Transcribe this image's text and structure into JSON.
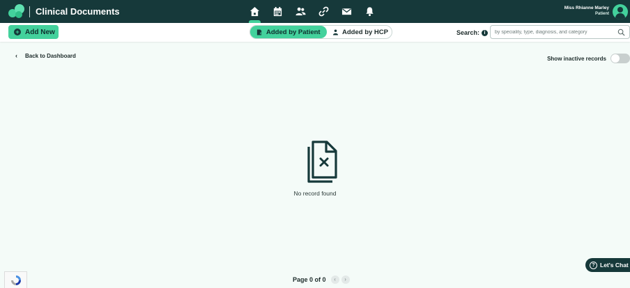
{
  "header": {
    "app_title": "Clinical Documents",
    "nav_icons": [
      "home-icon",
      "calendar-icon",
      "users-icon",
      "link-icon",
      "mail-icon",
      "bell-icon"
    ],
    "active_nav": "home-icon",
    "user": {
      "name": "Miss Rhianne Marley",
      "role": "Patient"
    }
  },
  "toolbar": {
    "add_label": "Add New",
    "tabs": [
      {
        "label": "Added by Patient",
        "active": true
      },
      {
        "label": "Added by HCP",
        "active": false
      }
    ],
    "search": {
      "label": "Search:",
      "placeholder": "by speciality, type, diagnosis, and category"
    }
  },
  "content": {
    "back_label": "Back to Dashboard",
    "inactive_label": "Show inactive records",
    "inactive_enabled": false,
    "empty_text": "No record found"
  },
  "pagination": {
    "text": "Page 0 of 0"
  },
  "chat": {
    "label": "Let's Chat"
  },
  "colors": {
    "primary_dark": "#16393a",
    "accent": "#43d19c",
    "background": "#f4fbf8"
  }
}
